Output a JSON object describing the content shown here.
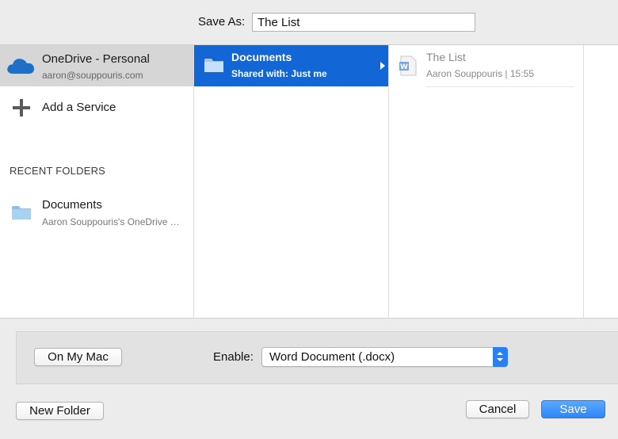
{
  "save_as": {
    "label": "Save As:",
    "value": "The List"
  },
  "sidebar": {
    "account": {
      "name": "OneDrive - Personal",
      "email": "aaron@souppouris.com",
      "icon": "cloud-icon"
    },
    "add_service": {
      "label": "Add a Service",
      "icon": "plus-icon"
    },
    "recent_title": "RECENT FOLDERS",
    "recent_items": [
      {
        "name": "Documents",
        "path": "Aaron Souppouris's OneDrive …",
        "icon": "folder-icon"
      }
    ]
  },
  "column2": {
    "folder": {
      "name": "Documents",
      "shared": "Shared with: Just me",
      "icon": "folder-icon"
    }
  },
  "column3": {
    "file": {
      "name": "The List",
      "meta": "Aaron Souppouris | 15:55",
      "icon": "word-document-icon"
    }
  },
  "options": {
    "on_my_mac": "On My Mac",
    "enable_label": "Enable:",
    "enable_value": "Word Document (.docx)"
  },
  "footer": {
    "new_folder": "New Folder",
    "cancel": "Cancel",
    "save": "Save"
  },
  "colors": {
    "accent": "#1266d6",
    "save_button": "#2f86f5",
    "onedrive_blue": "#1565c0"
  }
}
